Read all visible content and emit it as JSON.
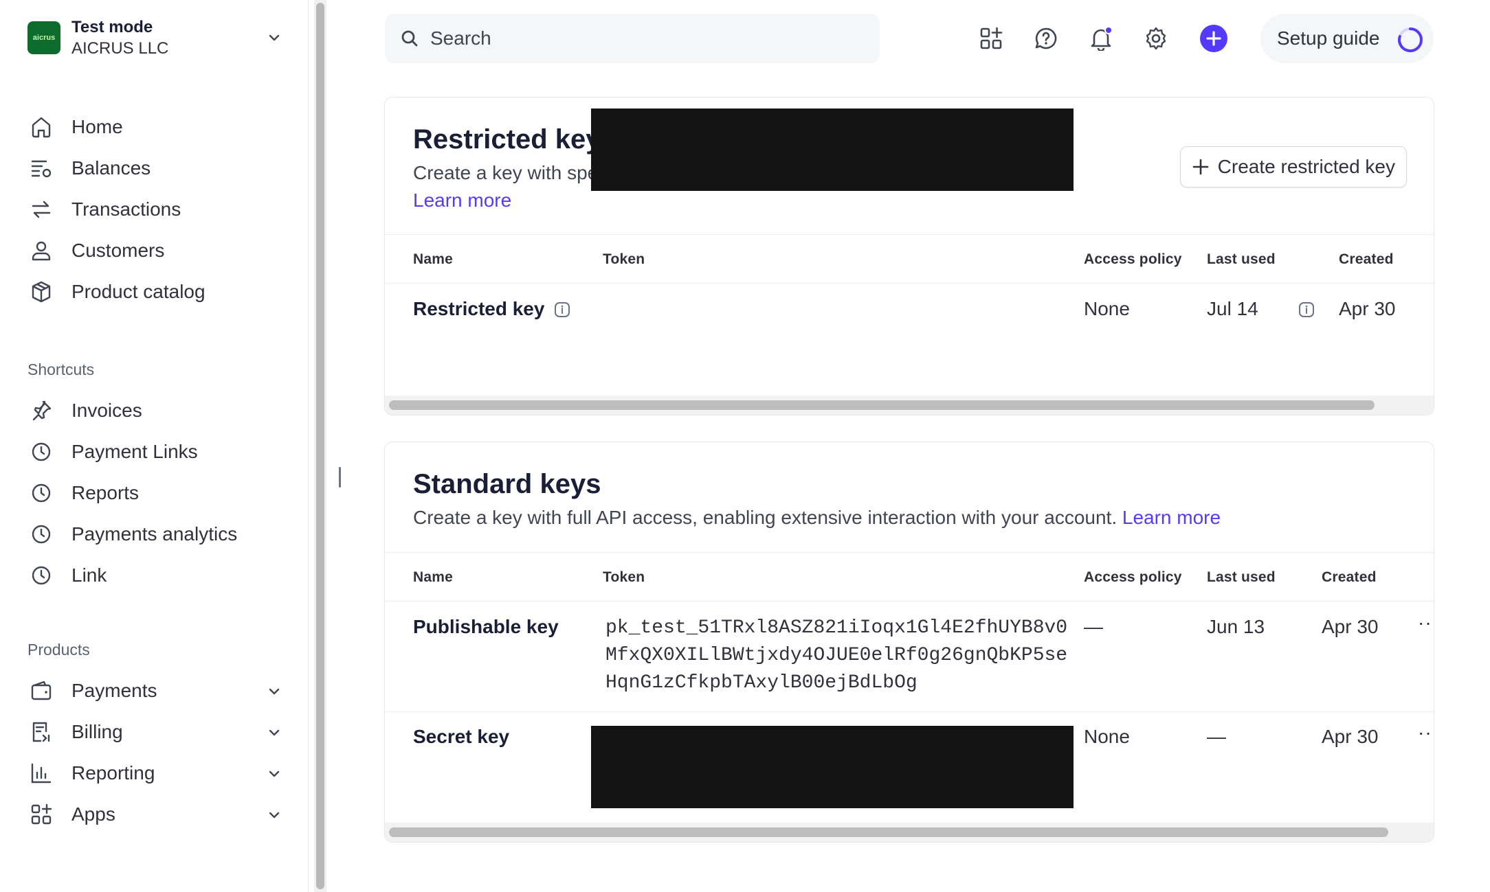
{
  "account": {
    "mode": "Test mode",
    "name": "AICRUS LLC",
    "logo_text": "aicrus"
  },
  "sidebar": {
    "main_items": [
      {
        "label": "Home",
        "icon": "home-icon"
      },
      {
        "label": "Balances",
        "icon": "balances-icon"
      },
      {
        "label": "Transactions",
        "icon": "transactions-icon"
      },
      {
        "label": "Customers",
        "icon": "person-icon"
      },
      {
        "label": "Product catalog",
        "icon": "cube-icon"
      }
    ],
    "shortcuts_title": "Shortcuts",
    "shortcuts": [
      {
        "label": "Invoices",
        "icon": "pin-icon"
      },
      {
        "label": "Payment Links",
        "icon": "clock-icon"
      },
      {
        "label": "Reports",
        "icon": "clock-icon"
      },
      {
        "label": "Payments analytics",
        "icon": "clock-icon"
      },
      {
        "label": "Link",
        "icon": "clock-icon"
      }
    ],
    "products_title": "Products",
    "products": [
      {
        "label": "Payments",
        "icon": "wallet-icon"
      },
      {
        "label": "Billing",
        "icon": "billing-icon"
      },
      {
        "label": "Reporting",
        "icon": "bar-chart-icon"
      },
      {
        "label": "Apps",
        "icon": "apps-icon"
      }
    ]
  },
  "header": {
    "search_placeholder": "Search",
    "setup_guide_label": "Setup guide"
  },
  "restricted": {
    "title": "Restricted keys",
    "description": "Create a key with specific access limits and permissions for greater security.",
    "learn_more": "Learn more",
    "create_button": "Create restricted key",
    "columns": {
      "name": "Name",
      "token": "Token",
      "access_policy": "Access policy",
      "last_used": "Last used",
      "created": "Created"
    },
    "rows": [
      {
        "name": "Restricted key",
        "access_policy": "None",
        "last_used": "Jul 14",
        "created": "Apr 30"
      }
    ]
  },
  "standard": {
    "title": "Standard keys",
    "description": "Create a key with full API access, enabling extensive interaction with your account.",
    "learn_more": "Learn more",
    "columns": {
      "name": "Name",
      "token": "Token",
      "access_policy": "Access policy",
      "last_used": "Last used",
      "created": "Created"
    },
    "rows": [
      {
        "name": "Publishable key",
        "token": "pk_test_51TRxl8ASZ821iIoqx1Gl4E2fhUYB8v0MfxQX0XILlBWtjxdy4OJUE0elRf0g26gnQbKP5seHqnG1zCfkpbTAxylB00ejBdLbOg",
        "access_policy": "—",
        "last_used": "Jun 13",
        "created": "Apr 30",
        "more": "···"
      },
      {
        "name": "Secret key",
        "access_policy": "None",
        "last_used": "—",
        "created": "Apr 30",
        "more": "···"
      }
    ]
  },
  "colors": {
    "accent": "#533afd",
    "logo_bg": "#0e6b2e",
    "redaction": "#141414"
  }
}
